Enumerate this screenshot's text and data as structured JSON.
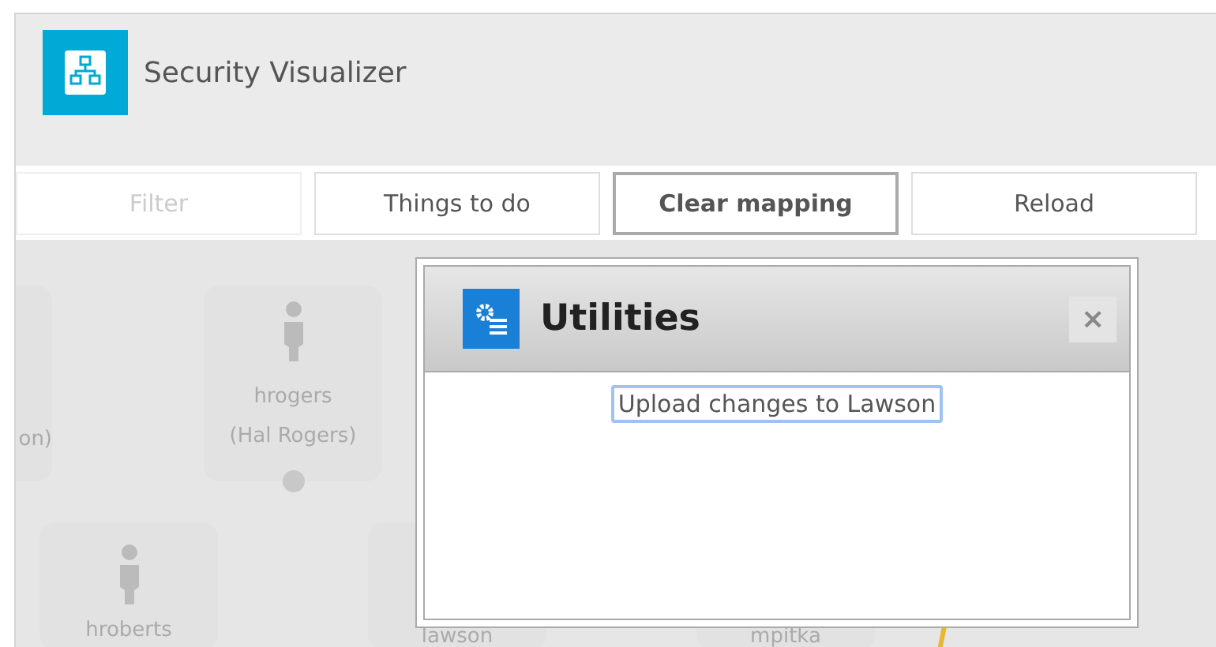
{
  "app": {
    "title": "Security Visualizer"
  },
  "toolbar": [
    {
      "label": "Filter",
      "disabled": true,
      "emphasis": false
    },
    {
      "label": "Things to do",
      "disabled": false,
      "emphasis": false
    },
    {
      "label": "Clear mapping",
      "disabled": false,
      "emphasis": true
    },
    {
      "label": "Reload",
      "disabled": false,
      "emphasis": false
    }
  ],
  "nodes": [
    {
      "lines": [
        "on)"
      ],
      "person": false
    },
    {
      "lines": [
        "hrogers",
        "(Hal Rogers)"
      ],
      "person": true,
      "dot": true
    },
    {
      "lines": [
        "hroberts"
      ],
      "person": true
    },
    {
      "lines": [
        "lawson"
      ],
      "person": false
    },
    {
      "lines": [
        "mpitka"
      ],
      "person": false
    }
  ],
  "dialog": {
    "title": "Utilities",
    "close": "×",
    "actions": [
      "Upload changes to Lawson"
    ]
  }
}
